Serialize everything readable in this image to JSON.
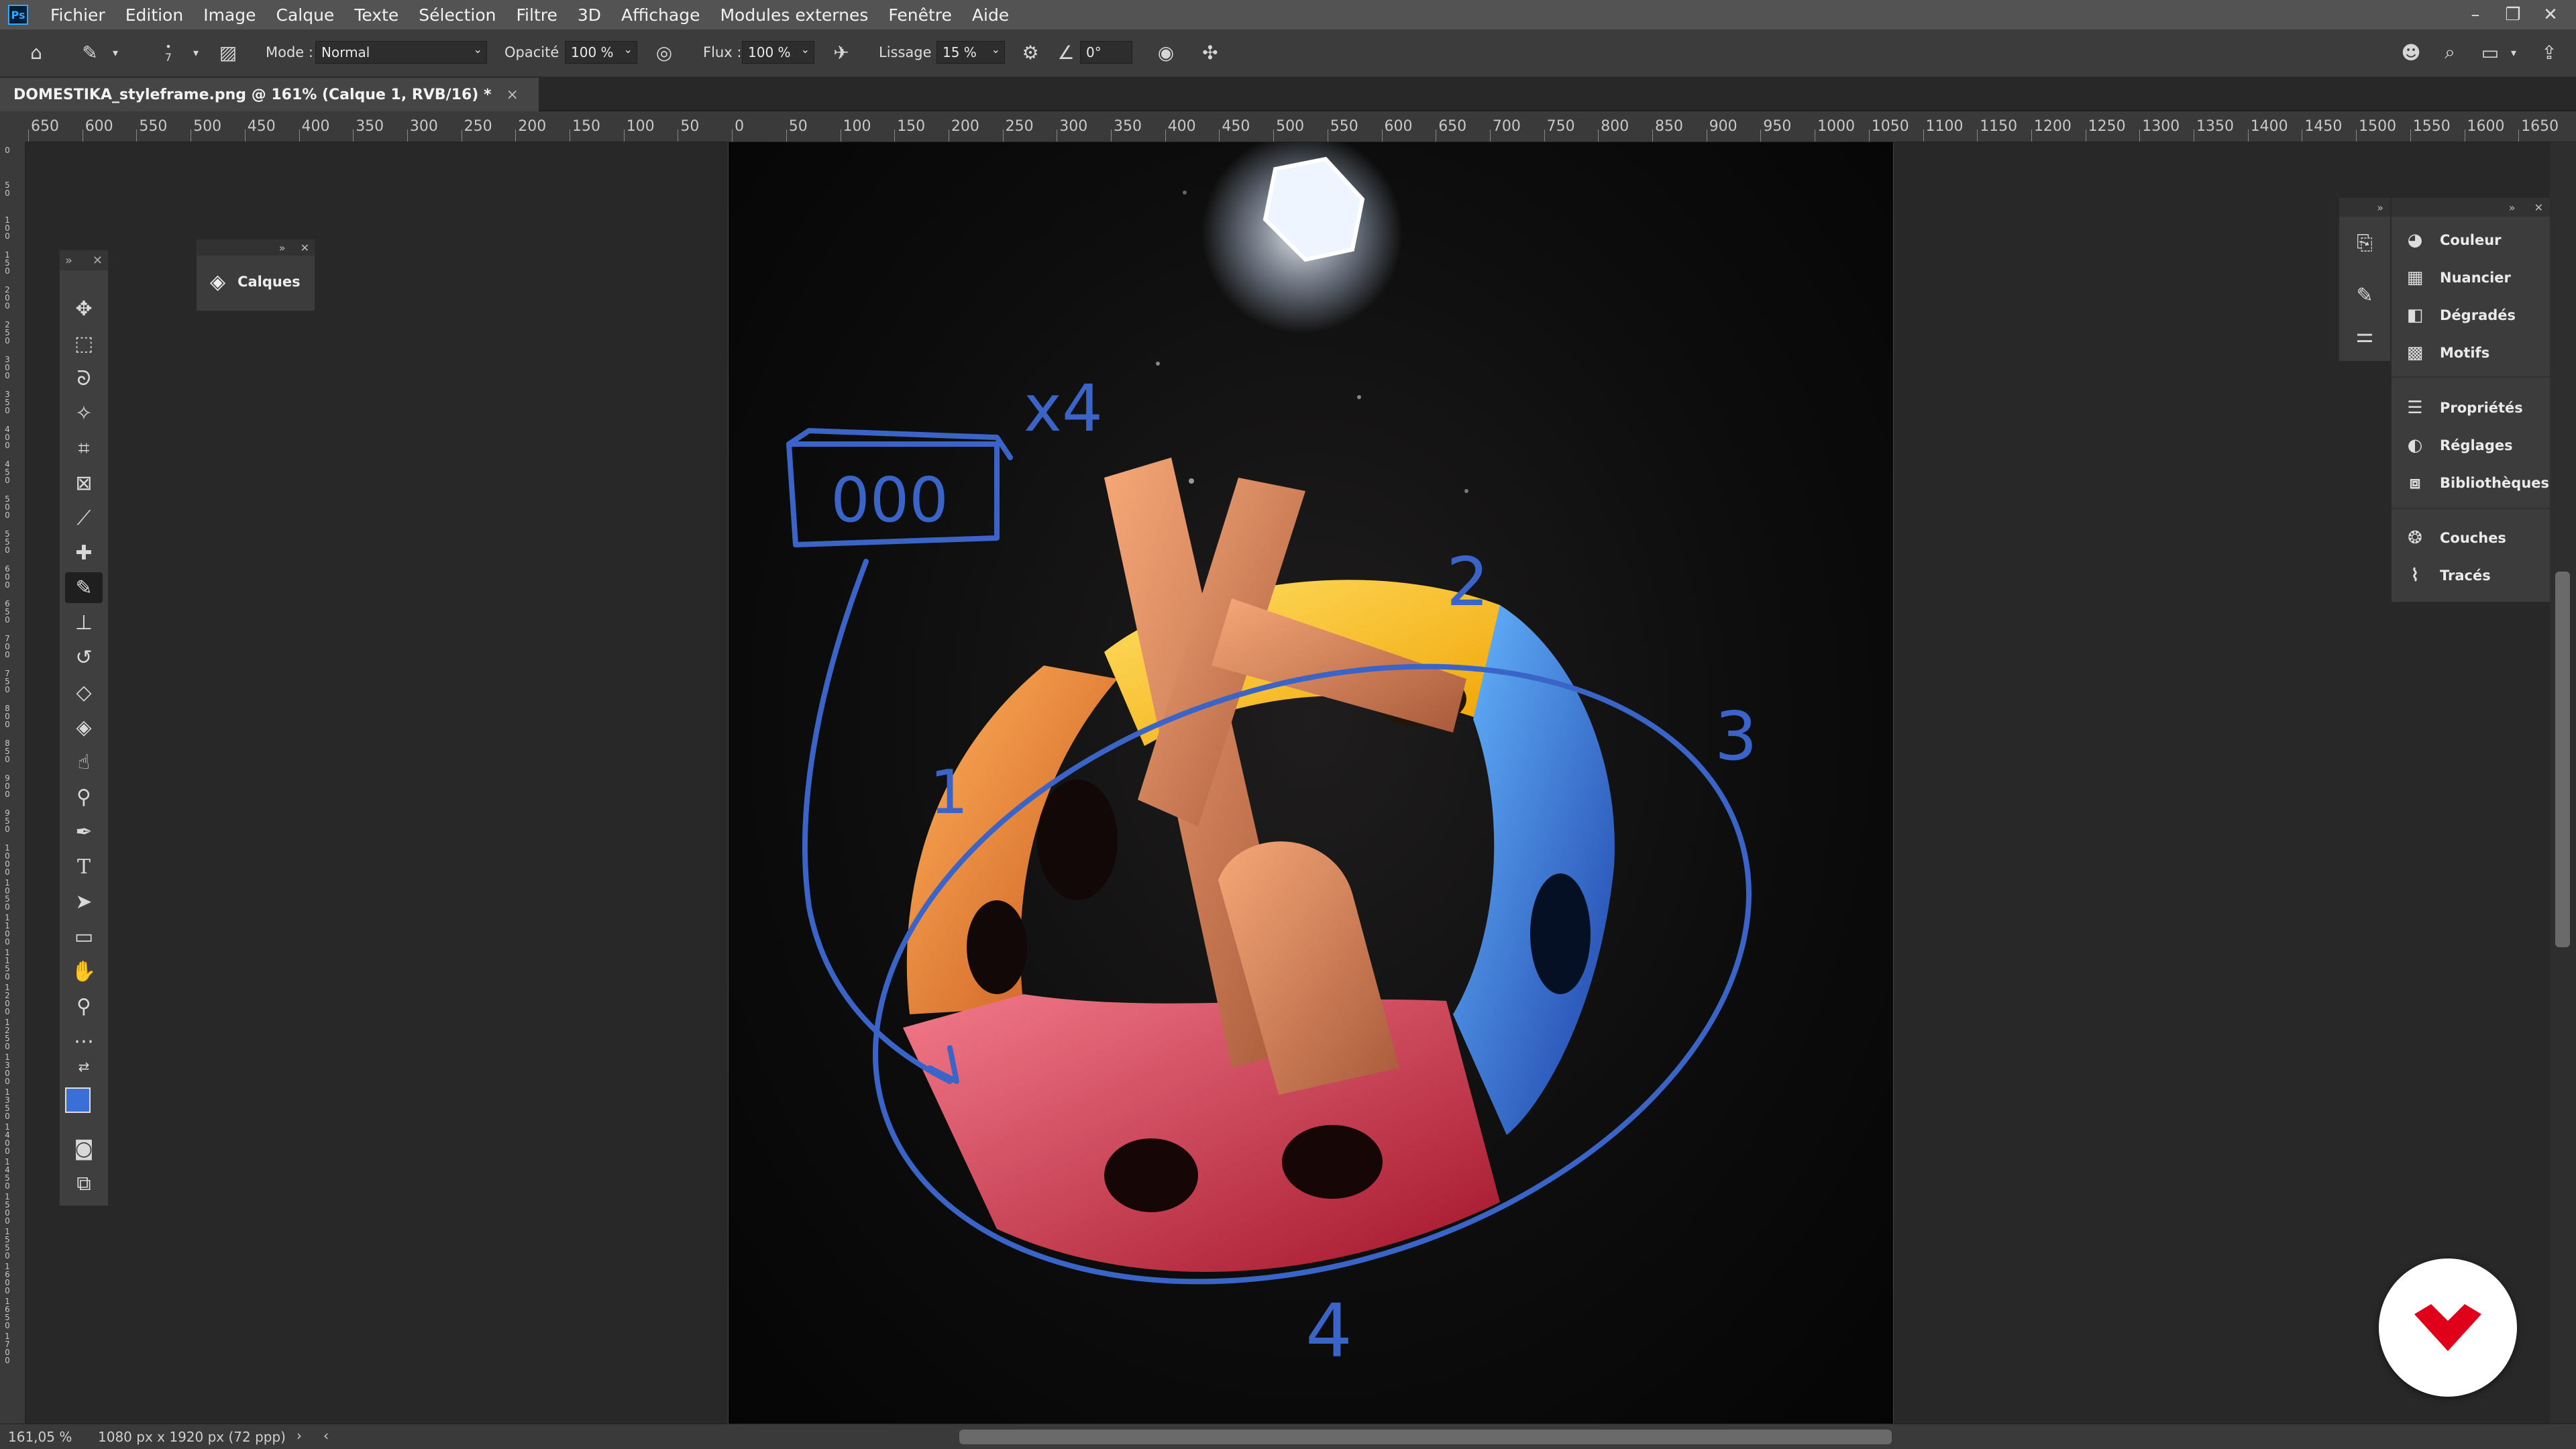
{
  "app": {
    "logo": "Ps"
  },
  "menu": [
    "Fichier",
    "Edition",
    "Image",
    "Calque",
    "Texte",
    "Sélection",
    "Filtre",
    "3D",
    "Affichage",
    "Modules externes",
    "Fenêtre",
    "Aide"
  ],
  "window_controls": [
    "minimize-icon",
    "restore-icon",
    "close-icon"
  ],
  "options": {
    "brush_size": "7",
    "mode_label": "Mode :",
    "mode_value": "Normal",
    "opacity_label": "Opacité :",
    "opacity_value": "100 %",
    "flow_label": "Flux :",
    "flow_value": "100 %",
    "smoothing_label": "Lissage :",
    "smoothing_value": "15 %",
    "angle_value": "0°"
  },
  "document": {
    "tab_title": "DOMESTIKA_styleframe.png @ 161% (Calque 1, RVB/16) *",
    "close": "×"
  },
  "ruler": {
    "h_labels": [
      "650",
      "600",
      "550",
      "500",
      "450",
      "400",
      "350",
      "300",
      "250",
      "200",
      "150",
      "100",
      "50",
      "0",
      "50",
      "100",
      "150",
      "200",
      "250",
      "300",
      "350",
      "400",
      "450",
      "500",
      "550",
      "600",
      "650",
      "700",
      "750",
      "800",
      "850",
      "900",
      "950",
      "1000",
      "1050",
      "1100",
      "1150",
      "1200",
      "1250",
      "1300",
      "1350",
      "1400",
      "1450",
      "1500",
      "1550",
      "1600",
      "1650"
    ],
    "v_labels": [
      "0",
      "50",
      "100",
      "150",
      "200",
      "250",
      "300",
      "350",
      "400",
      "450",
      "500",
      "550",
      "600",
      "650",
      "700",
      "750",
      "800",
      "850",
      "900",
      "950",
      "1000",
      "1050",
      "1100",
      "1150",
      "1200",
      "1250",
      "1300",
      "1350",
      "1400",
      "1450",
      "1500",
      "1550",
      "1600",
      "1650",
      "1700"
    ]
  },
  "panels": {
    "layers_label": "Calques",
    "right_items": [
      "Couleur",
      "Nuancier",
      "Dégradés",
      "Motifs",
      "Propriétés",
      "Réglages",
      "Bibliothèques",
      "Couches",
      "Tracés"
    ]
  },
  "annotations": {
    "count_label": "x4",
    "display_text": "000",
    "n1": "1",
    "n2": "2",
    "n3": "3",
    "n4": "4"
  },
  "status": {
    "zoom": "161,05 %",
    "doc_info": "1080 px x 1920 px (72 ppp)",
    "arrow": "›",
    "left_arrow": "‹"
  },
  "colors": {
    "foreground": "#3a6fd8",
    "background": "#ffffff",
    "sketch_stroke": "#3b64c8",
    "brand": "#e0001a"
  }
}
